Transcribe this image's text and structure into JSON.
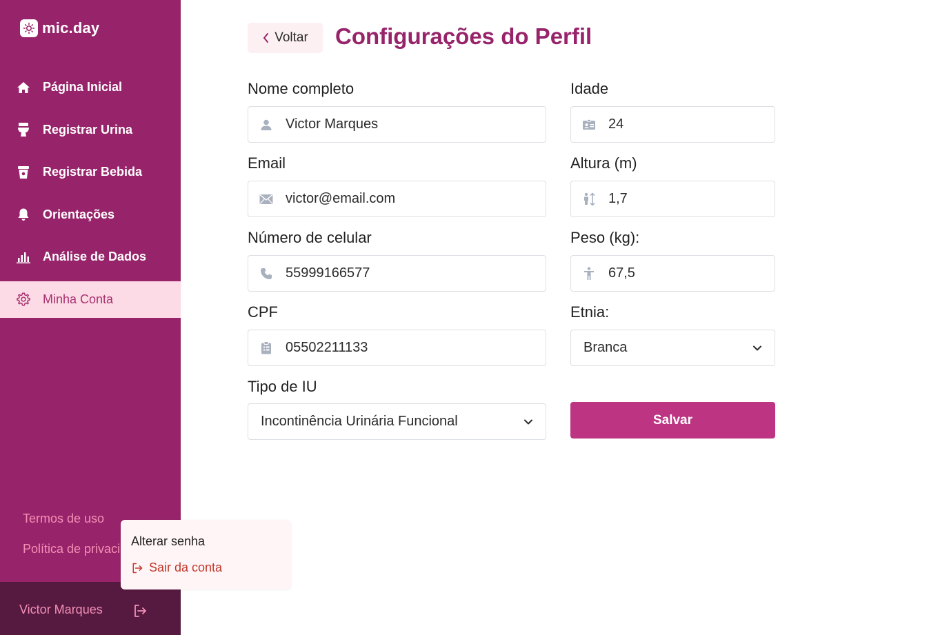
{
  "app": {
    "name": "mic.day"
  },
  "sidebar": {
    "items": [
      {
        "label": "Página Inicial",
        "icon": "home-icon"
      },
      {
        "label": "Registrar Urina",
        "icon": "toilet-icon"
      },
      {
        "label": "Registrar Bebida",
        "icon": "cup-icon"
      },
      {
        "label": "Orientações",
        "icon": "bell-icon"
      },
      {
        "label": "Análise de Dados",
        "icon": "bar-chart-icon"
      },
      {
        "label": "Minha Conta",
        "icon": "gear-icon",
        "active": true
      }
    ],
    "terms": "Termos de uso",
    "privacy": "Política de privacidade",
    "user_name": "Victor Marques"
  },
  "popup": {
    "change_password": "Alterar senha",
    "logout": "Sair da conta"
  },
  "header": {
    "back": "Voltar",
    "title": "Configurações do Perfil"
  },
  "form": {
    "full_name": {
      "label": "Nome completo",
      "value": "Victor Marques"
    },
    "email": {
      "label": "Email",
      "value": "victor@email.com"
    },
    "phone": {
      "label": "Número de celular",
      "value": "55999166577"
    },
    "cpf": {
      "label": "CPF",
      "value": "05502211133"
    },
    "iu_type": {
      "label": "Tipo de IU",
      "value": "Incontinência Urinária Funcional"
    },
    "age": {
      "label": "Idade",
      "value": "24"
    },
    "height": {
      "label": "Altura (m)",
      "value": "1,7"
    },
    "weight": {
      "label": "Peso (kg):",
      "value": "67,5"
    },
    "ethnicity": {
      "label": "Etnia:",
      "value": "Branca"
    },
    "save": "Salvar"
  },
  "colors": {
    "sidebar": "#97246a",
    "accent": "#bc3482",
    "active_bg": "#fddbe6",
    "user_bar": "#561a40",
    "link": "#f48fb7"
  }
}
